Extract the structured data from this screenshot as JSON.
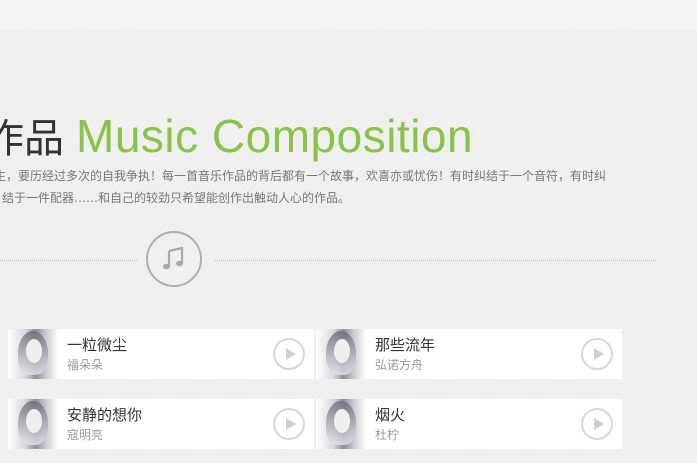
{
  "section": {
    "title_cn": "作品",
    "title_en": "Music Composition",
    "description_line1": "生，要历经过多次的自我争执！每一首音乐作品的背后都有一个故事，欢喜亦或忧伤！有时纠结于一个音符，有时纠",
    "description_line2": "结于一件配器……和自己的较劲只希望能创作出触动人心的作品。"
  },
  "colors": {
    "accent": "#8bc34a",
    "title": "#333333",
    "text_muted": "#777777"
  },
  "icons": {
    "divider_icon": "music-note-icon",
    "track_play": "play-icon"
  },
  "tracks": [
    {
      "name": "一粒微尘",
      "artist": "福朵朵"
    },
    {
      "name": "那些流年",
      "artist": "弘诺方舟"
    },
    {
      "name": "安静的想你",
      "artist": "寇明亮"
    },
    {
      "name": "烟火",
      "artist": "杜柠"
    }
  ]
}
